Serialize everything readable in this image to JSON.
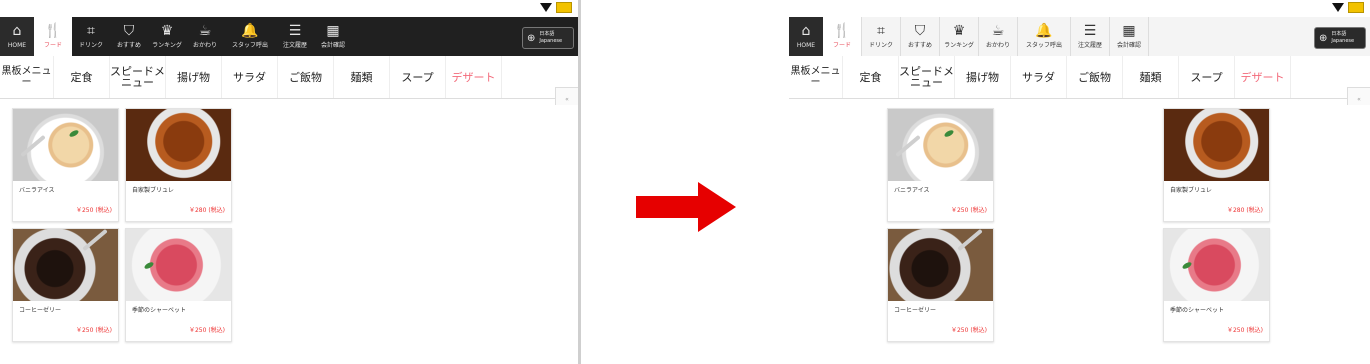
{
  "nav": {
    "home": "HOME",
    "items": [
      {
        "label": "フード",
        "icon": "fork-knife-icon"
      },
      {
        "label": "ドリンク",
        "icon": "drink-icon"
      },
      {
        "label": "おすすめ",
        "icon": "badge-icon"
      },
      {
        "label": "ランキング",
        "icon": "crown-icon"
      },
      {
        "label": "おかわり",
        "icon": "refill-icon"
      },
      {
        "label": "スタッフ呼出",
        "icon": "bell-icon"
      },
      {
        "label": "注文履歴",
        "icon": "history-icon"
      },
      {
        "label": "会計確認",
        "icon": "calculator-icon"
      }
    ],
    "language": {
      "line1": "日本語",
      "line2": "Japanese"
    }
  },
  "categories": [
    {
      "label": "黒板メニュー",
      "active": false
    },
    {
      "label": "定食",
      "active": false
    },
    {
      "label": "スピードメニュー",
      "active": false
    },
    {
      "label": "揚げ物",
      "active": false
    },
    {
      "label": "サラダ",
      "active": false
    },
    {
      "label": "ご飯物",
      "active": false
    },
    {
      "label": "麺類",
      "active": false
    },
    {
      "label": "スープ",
      "active": false
    },
    {
      "label": "デザート",
      "active": true
    }
  ],
  "collapse_label": "«",
  "items": [
    {
      "name": "バニラアイス",
      "price": "￥250 (税込)"
    },
    {
      "name": "自家製ブリュレ",
      "price": "￥280 (税込)"
    },
    {
      "name": "コーヒーゼリー",
      "price": "￥250 (税込)"
    },
    {
      "name": "季節のシャーベット",
      "price": "￥250 (税込)"
    }
  ],
  "colors": {
    "accent": "#f36b7b",
    "price": "#e33333",
    "arrow": "#e60000",
    "nav_bg": "#202020"
  }
}
